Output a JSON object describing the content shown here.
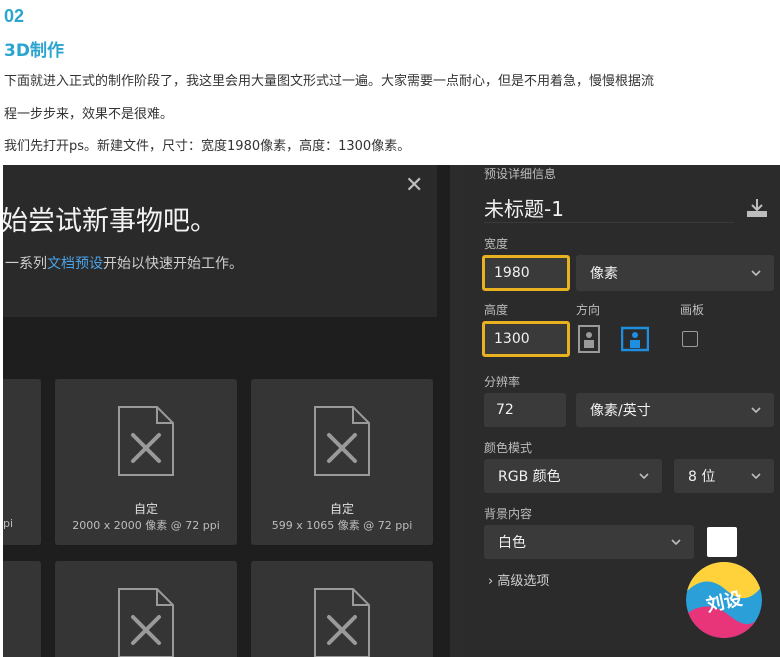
{
  "article": {
    "section_number": "02",
    "section_title": "3D制作",
    "paragraph_line1": "下面就进入正式的制作阶段了，我这里会用大量图文形式过一遍。大家需要一点耐心，但是不用着急，慢慢根据流",
    "paragraph_line2": "程一步步来，效果不是很难。",
    "paragraph_line3": "我们先打开ps。新建文件，尺寸：宽度1980像素，高度：1300像素。"
  },
  "dialog": {
    "hero_heading": "始尝试新事物吧。",
    "hero_sub_prefix": "一系列",
    "hero_sub_link": "文档预设",
    "hero_sub_suffix": "开始以快速开始工作。",
    "close_glyph": "✕",
    "presets": [
      {
        "name": "",
        "spec": "pi"
      },
      {
        "name": "自定",
        "spec": "2000 x 2000 像素 @ 72 ppi"
      },
      {
        "name": "自定",
        "spec": "599 x 1065 像素 @ 72 ppi"
      }
    ]
  },
  "details": {
    "section_label": "预设详细信息",
    "doc_title": "未标题-1",
    "width_label": "宽度",
    "width_value": "1980",
    "width_unit": "像素",
    "height_label": "高度",
    "height_value": "1300",
    "orientation_label": "方向",
    "artboard_label": "画板",
    "resolution_label": "分辨率",
    "resolution_value": "72",
    "resolution_unit": "像素/英寸",
    "color_mode_label": "颜色模式",
    "color_mode_value": "RGB 颜色",
    "bit_depth_value": "8 位",
    "background_label": "背景内容",
    "background_value": "白色",
    "advanced_label": "高级选项",
    "advanced_glyph": "›"
  },
  "colors": {
    "accent_blue": "#2ba4cf",
    "highlight_yellow": "#e8b120",
    "orientation_active": "#1e8fe0"
  },
  "badge": {
    "text": "刘设"
  }
}
